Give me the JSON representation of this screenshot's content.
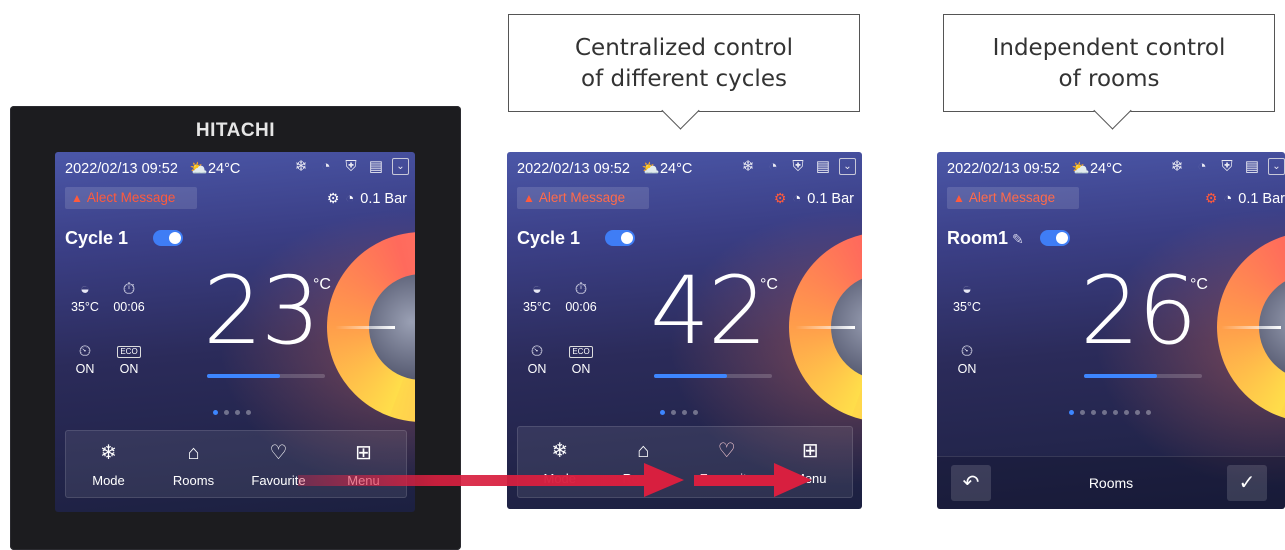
{
  "colors": {
    "accent": "#3d86ff",
    "alert": "#ff5a3c",
    "arrow": "#d81f3f"
  },
  "callouts": {
    "central": [
      "Centralized control",
      "of different cycles"
    ],
    "independent": [
      "Independent control",
      "of rooms"
    ]
  },
  "device": {
    "brand": "HITACHI"
  },
  "status_icons": [
    "snowflake-square-icon",
    "gauge-icon",
    "shield-icon",
    "schedule-icon",
    "chevron-down-icon"
  ],
  "screen1": {
    "datetime": "2022/02/13 09:52",
    "outdoor": "24°C",
    "alert": "Alect Message",
    "pressure": "0.1 Bar",
    "title": "Cycle 1",
    "stats": {
      "water_temp": "35°C",
      "timer": "00:06",
      "schedule": "ON",
      "eco": "ON",
      "eco_badge": "ECO"
    },
    "temperature": "23",
    "unit": "°C",
    "bar_fraction": 0.62,
    "page_dots": 4,
    "active_dot": 0,
    "nav": [
      "Mode",
      "Rooms",
      "Favourite",
      "Menu"
    ]
  },
  "screen2": {
    "datetime": "2022/02/13 09:52",
    "outdoor": "24°C",
    "alert": "Alert Message",
    "pressure": "0.1 Bar",
    "title": "Cycle 1",
    "stats": {
      "water_temp": "35°C",
      "timer": "00:06",
      "schedule": "ON",
      "eco": "ON",
      "eco_badge": "ECO"
    },
    "temperature": "42",
    "unit": "°C",
    "bar_fraction": 0.62,
    "page_dots": 4,
    "active_dot": 0,
    "nav": [
      "Mode",
      "Rooms",
      "Favourite",
      "Menu"
    ]
  },
  "screen3": {
    "datetime": "2022/02/13 09:52",
    "outdoor": "24°C",
    "alert": "Alert Message",
    "pressure": "0.1 Bar",
    "title": "Room1",
    "stats": {
      "water_temp": "35°C",
      "schedule": "ON"
    },
    "temperature": "26",
    "unit": "°C",
    "bar_fraction": 0.62,
    "page_dots": 8,
    "active_dot": 0,
    "bottom_label": "Rooms"
  }
}
